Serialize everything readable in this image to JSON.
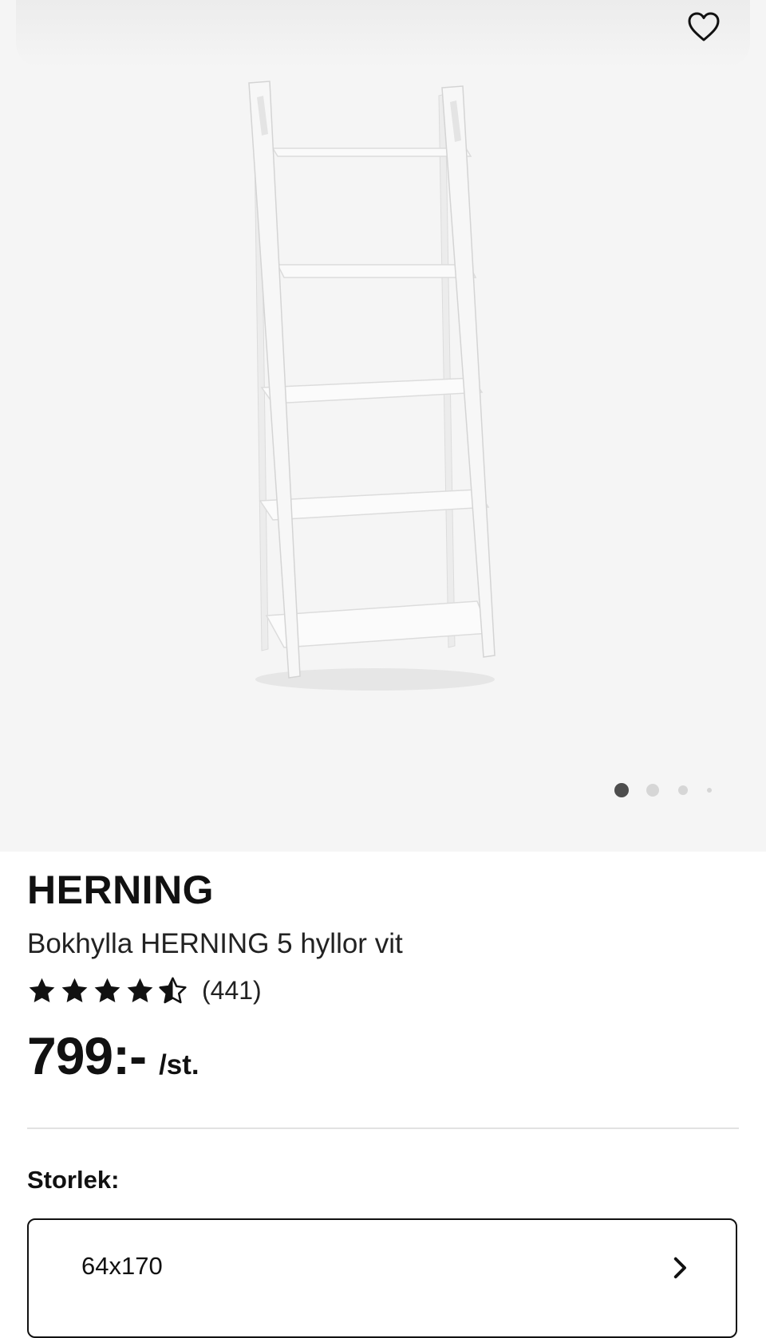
{
  "gallery": {
    "wishlist_icon": "heart-outline-icon",
    "image_alt": "Bokhylla HERNING 5 hyllor vit",
    "carousel": {
      "total_slides": 4,
      "active_slide": 1
    }
  },
  "product": {
    "name": "HERNING",
    "description": "Bokhylla HERNING 5 hyllor vit",
    "rating": {
      "stars": 4.5,
      "max": 5,
      "count_label": "(441)"
    },
    "price": {
      "amount": "799:-",
      "unit": "/st."
    }
  },
  "size": {
    "label": "Storlek:",
    "selected": "64x170",
    "chevron_icon": "chevron-right-icon"
  },
  "colors": {
    "gallery_background": "#f5f5f5",
    "text": "#111111",
    "dot_active": "#4d4d4d",
    "dot_inactive": "#d6d6d6",
    "divider": "#e2e2e2"
  }
}
